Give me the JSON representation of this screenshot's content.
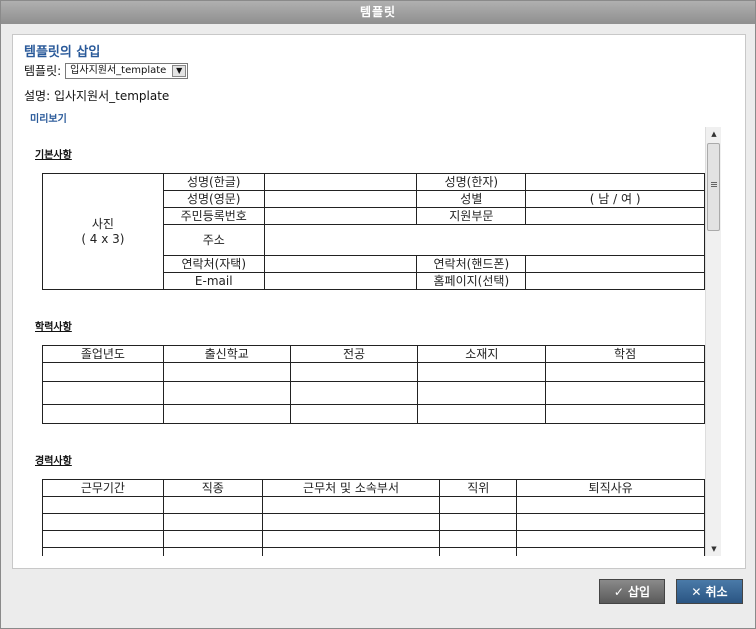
{
  "dialog": {
    "title": "템플릿"
  },
  "panel": {
    "heading": "템플릿의 삽입",
    "template_label": "템플릿:",
    "template_selected": "입사지원서_template",
    "description": "설명: 입사지원서_template",
    "preview_label": "미리보기"
  },
  "preview": {
    "sections": {
      "basic": "기본사항",
      "education": "학력사항",
      "career": "경력사항"
    },
    "basic": {
      "photo_label": "사진",
      "photo_size": "( 4 x 3)",
      "name_korean": "성명(한글)",
      "name_hanja": "성명(한자)",
      "name_english": "성명(영문)",
      "gender": "성별",
      "gender_value": "( 남 / 여 )",
      "resident_number": "주민등록번호",
      "department": "지원부문",
      "address": "주소",
      "phone_home": "연락처(자택)",
      "phone_mobile": "연락처(핸드폰)",
      "email": "E-mail",
      "homepage": "홈페이지(선택)"
    },
    "education_headers": [
      "졸업년도",
      "출신학교",
      "전공",
      "소재지",
      "학점"
    ],
    "career_headers": [
      "근무기간",
      "직종",
      "근무처 및 소속부서",
      "직위",
      "퇴직사유"
    ]
  },
  "buttons": {
    "insert": "삽입",
    "cancel": "취소"
  }
}
